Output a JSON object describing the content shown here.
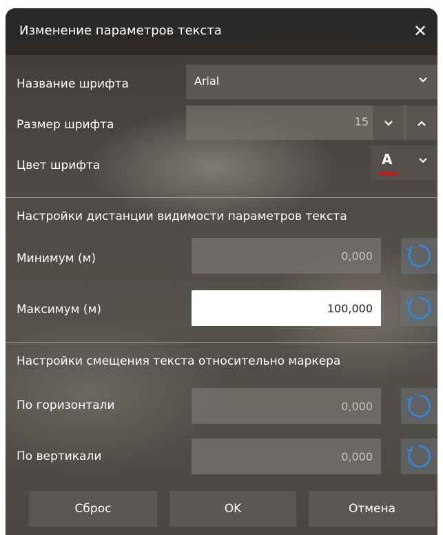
{
  "dialog": {
    "title": "Изменение параметров текста",
    "close_glyph": "✕"
  },
  "font": {
    "name_label": "Название шрифта",
    "name_value": "Arial",
    "size_label": "Размер шрифта",
    "size_value": "15",
    "color_label": "Цвет шрифта",
    "color_letter": "A",
    "color_value": "#e01010"
  },
  "visibility": {
    "section_title": "Настройки дистанции видимости параметров текста",
    "min_label": "Минимум (м)",
    "min_value": "0,000",
    "max_label": "Максимум (м)",
    "max_value": "100,000"
  },
  "offset": {
    "section_title": "Настройки смещения текста относительно маркера",
    "horizontal_label": "По горизонтали",
    "horizontal_value": "0,000",
    "vertical_label": "По вертикали",
    "vertical_value": "0,000"
  },
  "buttons": {
    "reset": "Сброс",
    "ok": "OK",
    "cancel": "Отмена"
  },
  "icons": {
    "chevron_down": "chevron-down-icon",
    "chevron_up": "chevron-up-icon",
    "reset": "reset-icon",
    "close": "close-icon"
  }
}
